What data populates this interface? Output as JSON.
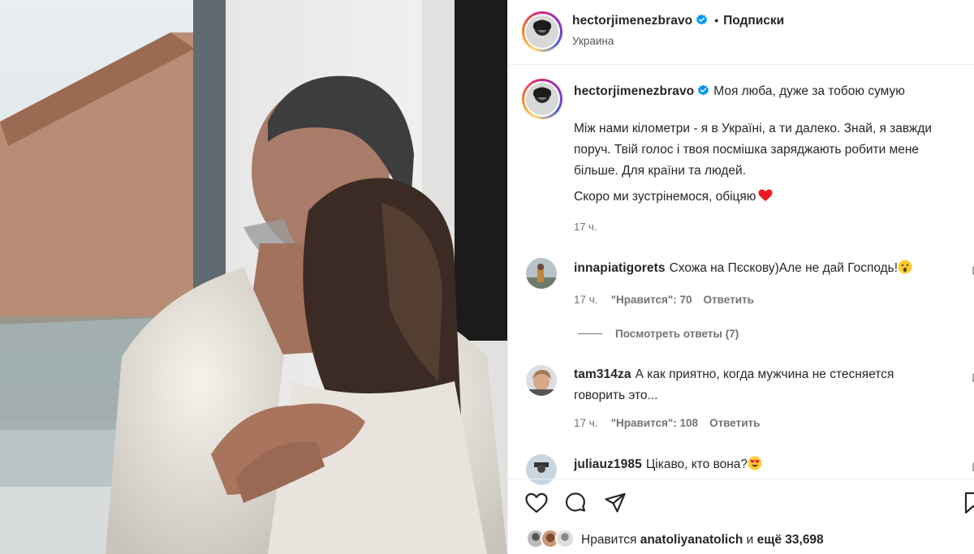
{
  "post": {
    "username": "hectorjimenezbravo",
    "dot": "•",
    "follow_label": "Подписки",
    "location": "Украина"
  },
  "caption": {
    "username": "hectorjimenezbravo",
    "first_line": "Моя люба, дуже за тобою сумую",
    "paragraph1": "Між нами кілометри - я в Україні, а ти далеко. Знай, я завжди поруч. Твій голос і твоя посмішка заряджають робити мене більше. Для країни та людей.",
    "paragraph2": "Скоро ми зустрінемося, обіцяю",
    "time": "17 ч."
  },
  "comments": [
    {
      "username": "innapiatigorets",
      "text": "Схожа на Пєскову)Але не дай Господь!",
      "emoji": "astonished-face",
      "time": "17 ч.",
      "likes": "\"Нравится\": 70",
      "reply": "Ответить",
      "view_replies": "Посмотреть ответы (7)"
    },
    {
      "username": "tam314za",
      "text": "А как приятно, когда мужчина не стесняется говорить это...",
      "time": "17 ч.",
      "likes": "\"Нравится\": 108",
      "reply": "Ответить"
    },
    {
      "username": "juliauz1985",
      "text": "Цікаво, кто вона?",
      "emoji": "heart-eyes-face"
    }
  ],
  "actions": {
    "likes_prefix": "Нравится",
    "likes_user": "anatoliyanatolich",
    "likes_mid": "и",
    "likes_more": "ещё 33,698"
  },
  "colors": {
    "verified": "#0095f6",
    "heart": "#ed1c24",
    "muted": "#737373"
  }
}
